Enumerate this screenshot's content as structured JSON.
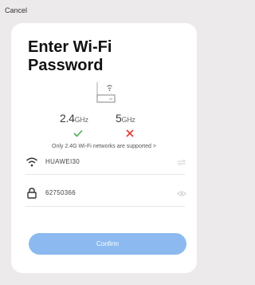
{
  "header": {
    "cancel_label": "Cancel"
  },
  "card": {
    "title": "Enter Wi-Fi Password",
    "router_icon": "router-icon",
    "bands": [
      {
        "value": "2.4",
        "unit": "GHz",
        "supported": true,
        "status_icon": "check-icon",
        "status_color": "#4caf50"
      },
      {
        "value": "5",
        "unit": "GHz",
        "supported": false,
        "status_icon": "cross-icon",
        "status_color": "#e53935"
      }
    ],
    "note": "Only 2.4G Wi-Fi networks are supported >",
    "ssid": {
      "icon": "wifi-icon",
      "value": "HUAWEI30",
      "trailing_icon": "swap-icon"
    },
    "password": {
      "icon": "lock-icon",
      "value": "62750366",
      "trailing_icon": "eye-icon"
    },
    "confirm_label": "Confirm",
    "accent_color": "#8cbaf0"
  }
}
